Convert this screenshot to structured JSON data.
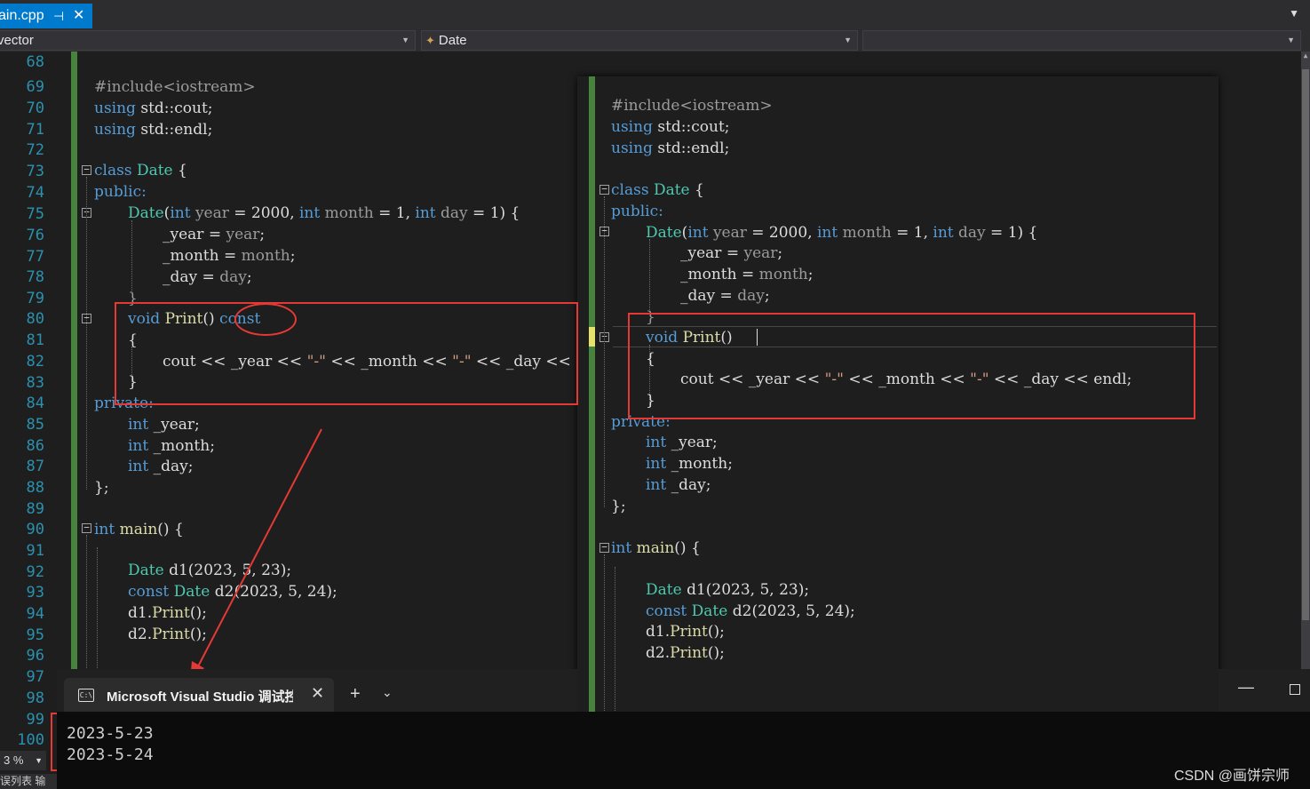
{
  "tab": {
    "label": "ain.cpp",
    "pin_icon": "pin-icon",
    "close_icon": "close-icon"
  },
  "navbar": {
    "scope": "vector",
    "member": "Date",
    "third": ""
  },
  "editor": {
    "line_numbers": [
      "68",
      "69",
      "70",
      "71",
      "72",
      "73",
      "74",
      "75",
      "76",
      "77",
      "78",
      "79",
      "80",
      "81",
      "82",
      "83",
      "84",
      "85",
      "86",
      "87",
      "88",
      "89",
      "90",
      "91",
      "92",
      "93",
      "94",
      "95",
      "96",
      "97",
      "98",
      "99",
      "100"
    ],
    "lines": {
      "l69": "#include<iostream>",
      "l70": "using std::cout;",
      "l71": "using std::endl;",
      "l73": "class Date {",
      "l74": "public:",
      "l75": "Date(int year = 2000, int month = 1, int day = 1) {",
      "l76": "_year = year;",
      "l77": "_month = month;",
      "l78": "_day = day;",
      "l79": "}",
      "l80_a": "void Print() ",
      "l80_b": "const",
      "l81": "{",
      "l82": "cout << _year << \"-\" << _month << \"-\" << _day <<",
      "l83": "}",
      "l84": "private:",
      "l85": "int _year;",
      "l86": "int _month;",
      "l87": "int _day;",
      "l88": "};",
      "l90": "int main() {",
      "l92": "Date d1(2023, 5, 23);",
      "l93": "const Date d2(2023, 5, 24);",
      "l94": "d1.Print();",
      "l95": "d2.Print();"
    }
  },
  "overlay": {
    "lines": {
      "o1": "#include<iostream>",
      "o2": "using std::cout;",
      "o3": "using std::endl;",
      "o5": "class Date {",
      "o6": "public:",
      "o7": "Date(int year = 2000, int month = 1, int day = 1) {",
      "o8": "_year = year;",
      "o9": "_month = month;",
      "o10": "_day = day;",
      "o11": "}",
      "o12": "void Print() ",
      "o13": "{",
      "o14": "cout << _year << \"-\" << _month << \"-\" << _day << endl;",
      "o15": "}",
      "o16": "private:",
      "o17": "int _year;",
      "o18": "int _month;",
      "o19": "int _day;",
      "o20": "};",
      "o22": "int main() {",
      "o24": "Date d1(2023, 5, 23);",
      "o25": "const Date d2(2023, 5, 24);",
      "o26": "d1.Print();",
      "o27": "d2.Print();"
    }
  },
  "console": {
    "tab_title": "Microsoft Visual Studio 调试控",
    "terminal_icon": "C:\\",
    "new_tab": "+",
    "dropdown": "⌄",
    "output": [
      "2023-5-23",
      "2023-5-24"
    ]
  },
  "window": {
    "minimize": "—"
  },
  "statusbar": {
    "zoom": "3 %",
    "bottom_tabs": "误列表 输"
  },
  "watermark": "CSDN @画饼宗师",
  "colors": {
    "keyword": "#569cd6",
    "type": "#4ec9b0",
    "annotation": "#e53935",
    "accent": "#007acc"
  }
}
